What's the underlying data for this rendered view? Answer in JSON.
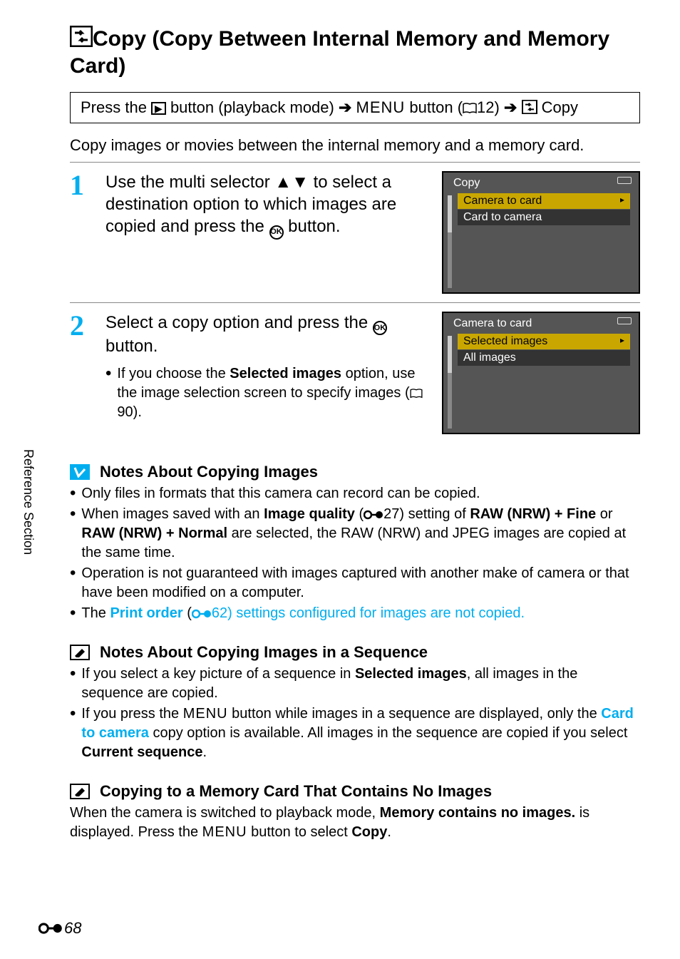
{
  "title_part1": "Copy (Copy Between Internal Memory and Memory Card)",
  "breadcrumb": {
    "prefix": "Press the ",
    "play_icon_label": "▶",
    "after_play": " button (playback mode) ",
    "menu_label": "MENU",
    "after_menu": " button (",
    "page_ref1": "12) ",
    "copy_label": " Copy"
  },
  "intro": "Copy images or movies between the internal memory and a memory card.",
  "steps": [
    {
      "num": "1",
      "text_pre": "Use the multi selector ",
      "text_post": " to select a destination option to which images are copied and press the ",
      "ok": "OK",
      "text_end": " button.",
      "screenshot": {
        "title": "Copy",
        "items": [
          "Camera to card",
          "Card to camera"
        ],
        "highlight_index": 0
      }
    },
    {
      "num": "2",
      "text_pre": "Select a copy option and press the ",
      "ok": "OK",
      "text_end": " button.",
      "sub_pre": "If you choose the ",
      "sub_strong": "Selected images",
      "sub_mid": " option, use the image selection screen to specify images (",
      "sub_ref": "90).",
      "screenshot": {
        "title": "Camera to card",
        "items": [
          "Selected images",
          "All images"
        ],
        "highlight_index": 0
      }
    }
  ],
  "notes1": {
    "heading": "Notes About Copying Images",
    "items": [
      {
        "plain": "Only files in formats that this camera can record can be copied."
      },
      {
        "pre": "When images saved with an ",
        "s1": "Image quality",
        "mid1": " (",
        "ref1": "27) setting of ",
        "s2": "RAW (NRW) + Fine",
        "mid2": " or ",
        "s3": "RAW (NRW) + Normal",
        "post": " are selected, the RAW (NRW) and JPEG images are copied at the same time."
      },
      {
        "plain": "Operation is not guaranteed with images captured with another make of camera or that have been modified on a computer."
      },
      {
        "pre": "The ",
        "s1": "Print order",
        "mid1": " (",
        "ref1": "62) settings configured for images are not copied."
      }
    ]
  },
  "notes2": {
    "heading": "Notes About Copying Images in a Sequence",
    "items": [
      {
        "pre": "If you select a key picture of a sequence in ",
        "s1": "Selected images",
        "post": ", all images in the sequence are copied."
      },
      {
        "pre": "If you press the ",
        "menu": "MENU",
        "mid1": " button while images in a sequence are displayed, only the ",
        "s1": "Card to camera",
        "mid2": " copy option is available. All images in the sequence are copied if you select ",
        "s2": "Current sequence",
        "post": "."
      }
    ]
  },
  "notes3": {
    "heading": "Copying to a Memory Card That Contains No Images",
    "para_pre": "When the camera is switched to playback mode, ",
    "para_s1": "Memory contains no images.",
    "para_mid": " is displayed. Press the ",
    "para_menu": "MENU",
    "para_mid2": " button to select ",
    "para_s2": "Copy",
    "para_post": "."
  },
  "side_text": "Reference Section",
  "page_num": "68"
}
